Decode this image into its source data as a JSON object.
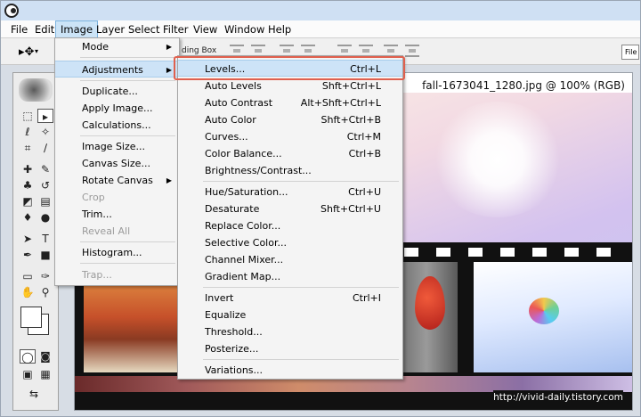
{
  "menubar": {
    "items": [
      "File",
      "Edit",
      "Image",
      "Layer",
      "Select",
      "Filter",
      "View",
      "Window",
      "Help"
    ],
    "active": "Image"
  },
  "options_bar": {
    "partial_text": "ding Box",
    "right_partial": "File"
  },
  "document": {
    "title": "fall-1673041_1280.jpg @ 100% (RGB)"
  },
  "image_menu": {
    "mode": "Mode",
    "adjustments": "Adjustments",
    "duplicate": "Duplicate...",
    "apply_image": "Apply Image...",
    "calculations": "Calculations...",
    "image_size": "Image Size...",
    "canvas_size": "Canvas Size...",
    "rotate_canvas": "Rotate Canvas",
    "crop": "Crop",
    "trim": "Trim...",
    "reveal_all": "Reveal All",
    "histogram": "Histogram...",
    "trap": "Trap..."
  },
  "adjustments_menu": {
    "levels": {
      "label": "Levels...",
      "shortcut": "Ctrl+L"
    },
    "auto_levels": {
      "label": "Auto Levels",
      "shortcut": "Shft+Ctrl+L"
    },
    "auto_contrast": {
      "label": "Auto Contrast",
      "shortcut": "Alt+Shft+Ctrl+L"
    },
    "auto_color": {
      "label": "Auto Color",
      "shortcut": "Shft+Ctrl+B"
    },
    "curves": {
      "label": "Curves...",
      "shortcut": "Ctrl+M"
    },
    "color_balance": {
      "label": "Color Balance...",
      "shortcut": "Ctrl+B"
    },
    "brightness_contrast": {
      "label": "Brightness/Contrast...",
      "shortcut": ""
    },
    "hue_saturation": {
      "label": "Hue/Saturation...",
      "shortcut": "Ctrl+U"
    },
    "desaturate": {
      "label": "Desaturate",
      "shortcut": "Shft+Ctrl+U"
    },
    "replace_color": {
      "label": "Replace Color...",
      "shortcut": ""
    },
    "selective_color": {
      "label": "Selective Color...",
      "shortcut": ""
    },
    "channel_mixer": {
      "label": "Channel Mixer...",
      "shortcut": ""
    },
    "gradient_map": {
      "label": "Gradient Map...",
      "shortcut": ""
    },
    "invert": {
      "label": "Invert",
      "shortcut": "Ctrl+I"
    },
    "equalize": {
      "label": "Equalize",
      "shortcut": ""
    },
    "threshold": {
      "label": "Threshold...",
      "shortcut": ""
    },
    "posterize": {
      "label": "Posterize...",
      "shortcut": ""
    },
    "variations": {
      "label": "Variations...",
      "shortcut": ""
    }
  },
  "watermark": "http://vivid-daily.tistory.com",
  "colors": {
    "menu_highlight": "#cde3f7",
    "annotation_box": "#e0604e",
    "titlebar": "#cfe0f3"
  }
}
